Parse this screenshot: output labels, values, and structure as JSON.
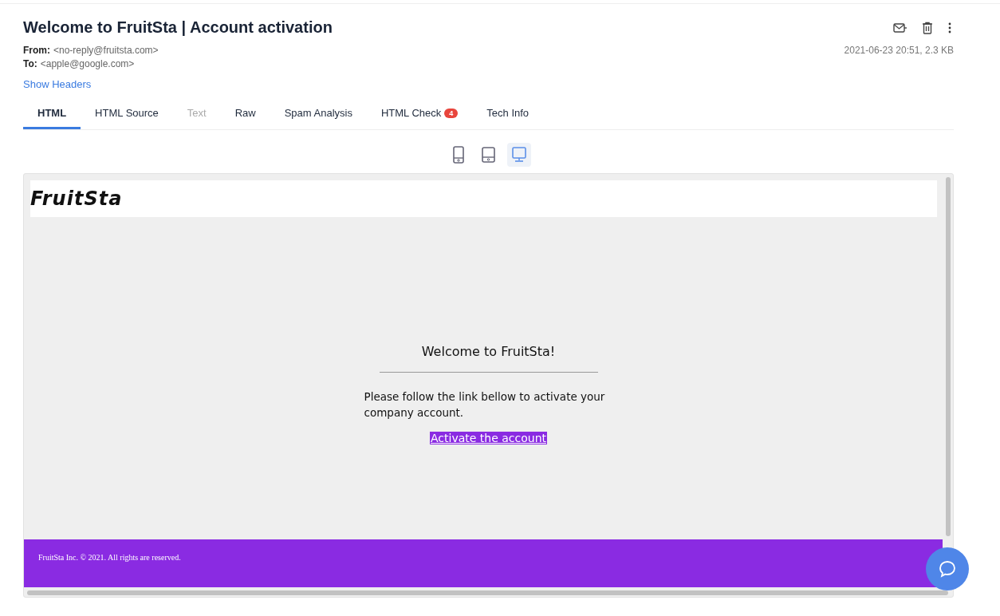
{
  "email": {
    "subject": "Welcome to FruitSta | Account activation",
    "from_label": "From:",
    "from": "<no-reply@fruitsta.com>",
    "to_label": "To:",
    "to": "<apple@google.com>",
    "date_size": "2021-06-23 20:51, 2.3 KB",
    "show_headers": "Show Headers"
  },
  "tabs": [
    {
      "label": "HTML",
      "selected": true,
      "disabled": false
    },
    {
      "label": "HTML Source",
      "selected": false,
      "disabled": false
    },
    {
      "label": "Text",
      "selected": false,
      "disabled": true
    },
    {
      "label": "Raw",
      "selected": false,
      "disabled": false
    },
    {
      "label": "Spam Analysis",
      "selected": false,
      "disabled": false
    },
    {
      "label": "HTML Check",
      "selected": false,
      "disabled": false,
      "badge": "4"
    },
    {
      "label": "Tech Info",
      "selected": false,
      "disabled": false
    }
  ],
  "devices": [
    {
      "kind": "phone",
      "selected": false
    },
    {
      "kind": "tablet",
      "selected": false
    },
    {
      "kind": "desktop",
      "selected": true
    }
  ],
  "preview": {
    "logo": "FruitSta",
    "heading": "Welcome to FruitSta!",
    "body": "Please follow the link bellow to activate your company account.",
    "link": "Activate the account",
    "footer": "FruitSta Inc. © 2021. All rights are reserved."
  }
}
